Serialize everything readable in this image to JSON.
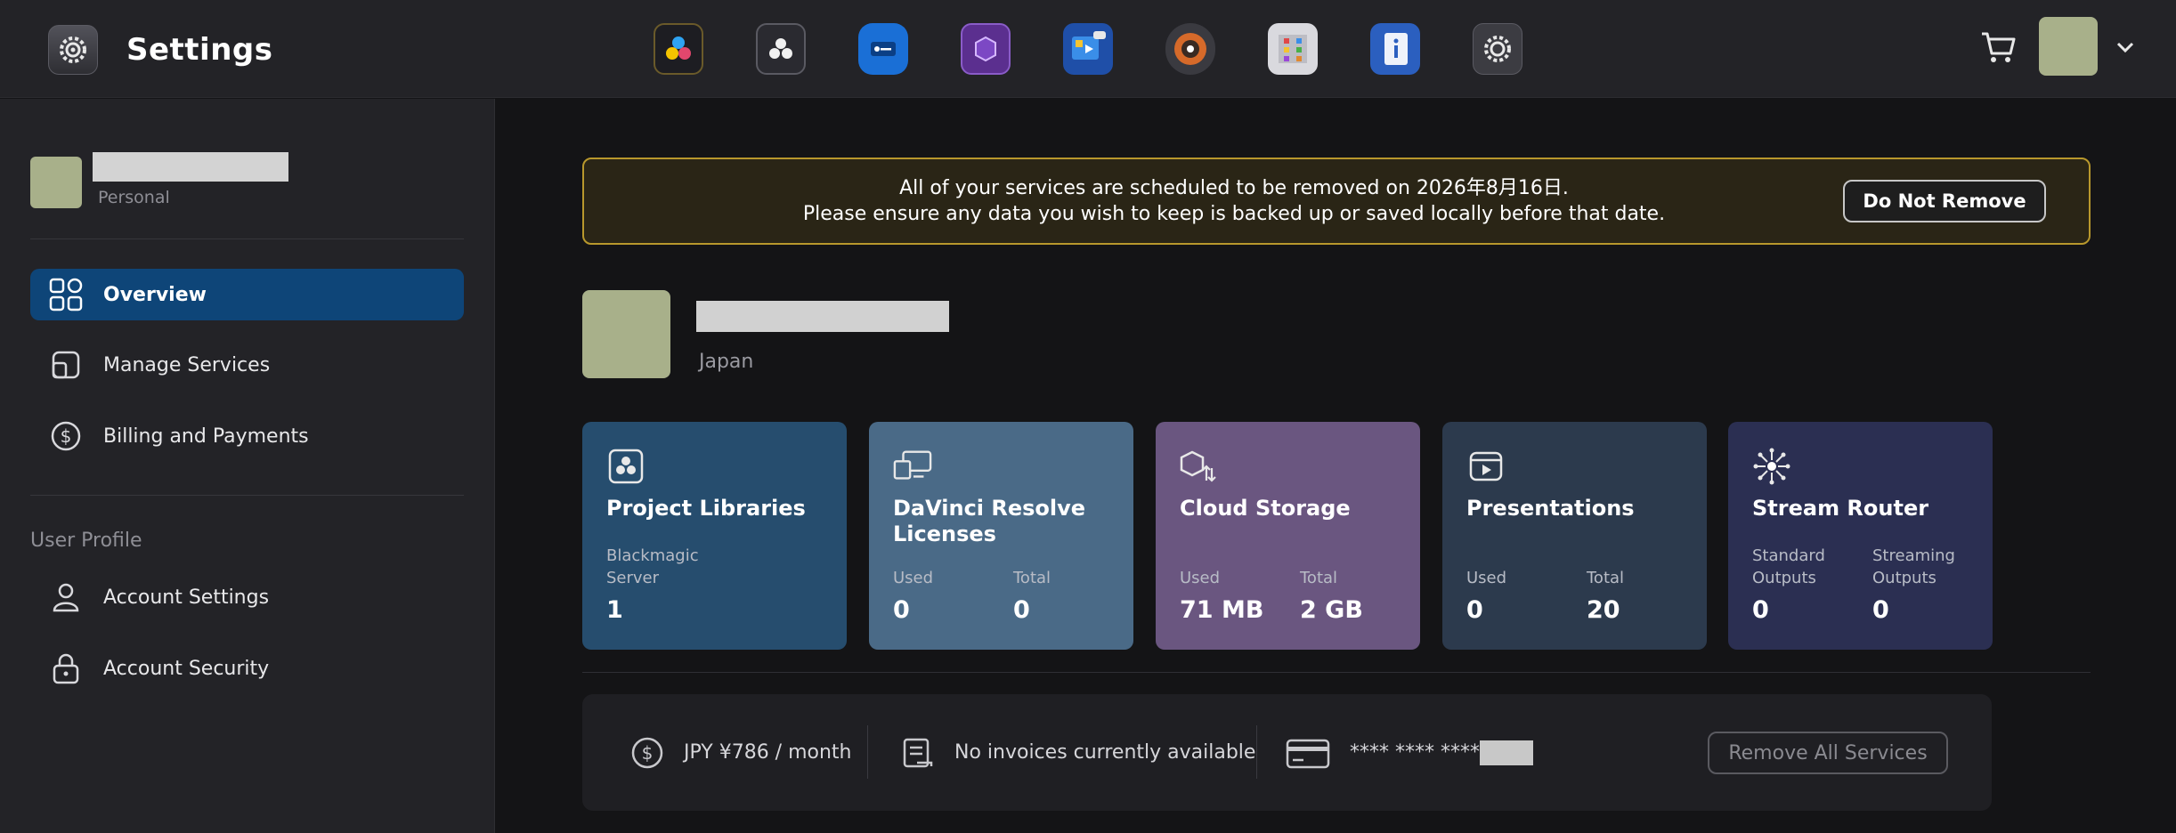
{
  "header": {
    "title": "Settings",
    "apps": [
      {
        "icon": "davinci-resolve-icon"
      },
      {
        "icon": "blackmagic-cloud-icon"
      },
      {
        "icon": "license-key-icon"
      },
      {
        "icon": "fusion-icon"
      },
      {
        "icon": "presentations-icon"
      },
      {
        "icon": "stream-router-icon"
      },
      {
        "icon": "project-library-icon"
      },
      {
        "icon": "info-icon"
      },
      {
        "icon": "settings-icon"
      }
    ]
  },
  "sidebar": {
    "profile_type": "Personal",
    "items": [
      {
        "label": "Overview",
        "icon": "overview-icon"
      },
      {
        "label": "Manage Services",
        "icon": "manage-services-icon"
      },
      {
        "label": "Billing and Payments",
        "icon": "dollar-icon"
      }
    ],
    "section_label": "User Profile",
    "profile_items": [
      {
        "label": "Account Settings",
        "icon": "user-icon"
      },
      {
        "label": "Account Security",
        "icon": "lock-icon"
      }
    ]
  },
  "banner": {
    "line1": "All of your services are scheduled to be removed on 2026年8月16日.",
    "line2": "Please ensure any data you wish to keep is backed up or saved locally before that date.",
    "button": "Do Not Remove"
  },
  "account": {
    "country": "Japan"
  },
  "cards": [
    {
      "title": "Project Libraries",
      "color": "#264d6e",
      "stats": [
        {
          "label": "Blackmagic Server",
          "value": "1"
        }
      ]
    },
    {
      "title": "DaVinci Resolve Licenses",
      "color": "#4a6a87",
      "stats": [
        {
          "label": "Used",
          "value": "0"
        },
        {
          "label": "Total",
          "value": "0"
        }
      ]
    },
    {
      "title": "Cloud Storage",
      "color": "#6a5680",
      "stats": [
        {
          "label": "Used",
          "value": "71 MB"
        },
        {
          "label": "Total",
          "value": "2 GB"
        }
      ]
    },
    {
      "title": "Presentations",
      "color": "#2c3a4d",
      "stats": [
        {
          "label": "Used",
          "value": "0"
        },
        {
          "label": "Total",
          "value": "20"
        }
      ]
    },
    {
      "title": "Stream Router",
      "color": "#2b2f52",
      "stats": [
        {
          "label": "Standard Outputs",
          "value": "0"
        },
        {
          "label": "Streaming Outputs",
          "value": "0"
        }
      ]
    }
  ],
  "footer": {
    "price": "JPY ¥786 / month",
    "invoices": "No invoices currently available",
    "card_number": "**** **** ****",
    "remove_button": "Remove All Services"
  }
}
